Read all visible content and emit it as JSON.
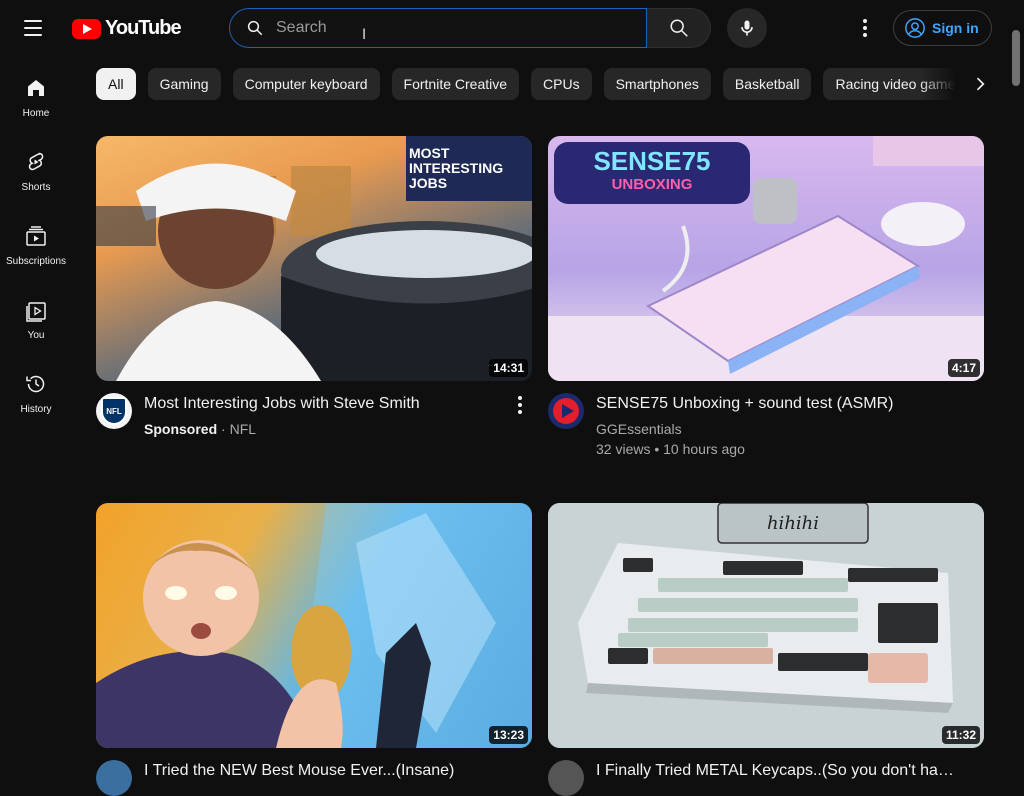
{
  "header": {
    "logo_text": "YouTube",
    "search_placeholder": "Search",
    "signin_label": "Sign in"
  },
  "sidebar": {
    "items": [
      {
        "label": "Home",
        "icon": "home-icon"
      },
      {
        "label": "Shorts",
        "icon": "shorts-icon"
      },
      {
        "label": "Subscriptions",
        "icon": "subscriptions-icon"
      },
      {
        "label": "You",
        "icon": "you-icon"
      },
      {
        "label": "History",
        "icon": "history-icon"
      }
    ]
  },
  "chips": [
    "All",
    "Gaming",
    "Computer keyboard",
    "Fortnite Creative",
    "CPUs",
    "Smartphones",
    "Basketball",
    "Racing video games"
  ],
  "videos": [
    {
      "title": "Most Interesting Jobs with Steve Smith",
      "sponsored": "Sponsored",
      "channel": "NFL",
      "stats": "",
      "duration": "14:31",
      "thumb_text": "MOST INTERESTING JOBS",
      "avatar_text": "NFL",
      "colors": {
        "bg1": "#f3a95b",
        "bg2": "#4a5a6e",
        "avatar": "#013369"
      }
    },
    {
      "title": "SENSE75 Unboxing + sound test (ASMR)",
      "sponsored": "",
      "channel": "GGEssentials",
      "stats": "32 views • 10 hours ago",
      "duration": "4:17",
      "thumb_text": "SENSE75",
      "thumb_text2": "UNBOXING",
      "colors": {
        "bg1": "#c9a9e8",
        "bg2": "#8fa0e0",
        "avatar": "#1b2a6b"
      }
    },
    {
      "title": "I Tried the NEW Best Mouse Ever...(Insane)",
      "sponsored": "",
      "channel": "",
      "stats": "",
      "duration": "13:23",
      "colors": {
        "bg1": "#f0a020",
        "bg2": "#4aa8e0",
        "avatar": "#555"
      }
    },
    {
      "title": "I Finally Tried METAL Keycaps..(So you don't have to)",
      "sponsored": "",
      "channel": "",
      "stats": "",
      "duration": "11:32",
      "thumb_text": "hihihi",
      "colors": {
        "bg1": "#cfd8dc",
        "bg2": "#90a4ae",
        "avatar": "#444"
      }
    }
  ]
}
